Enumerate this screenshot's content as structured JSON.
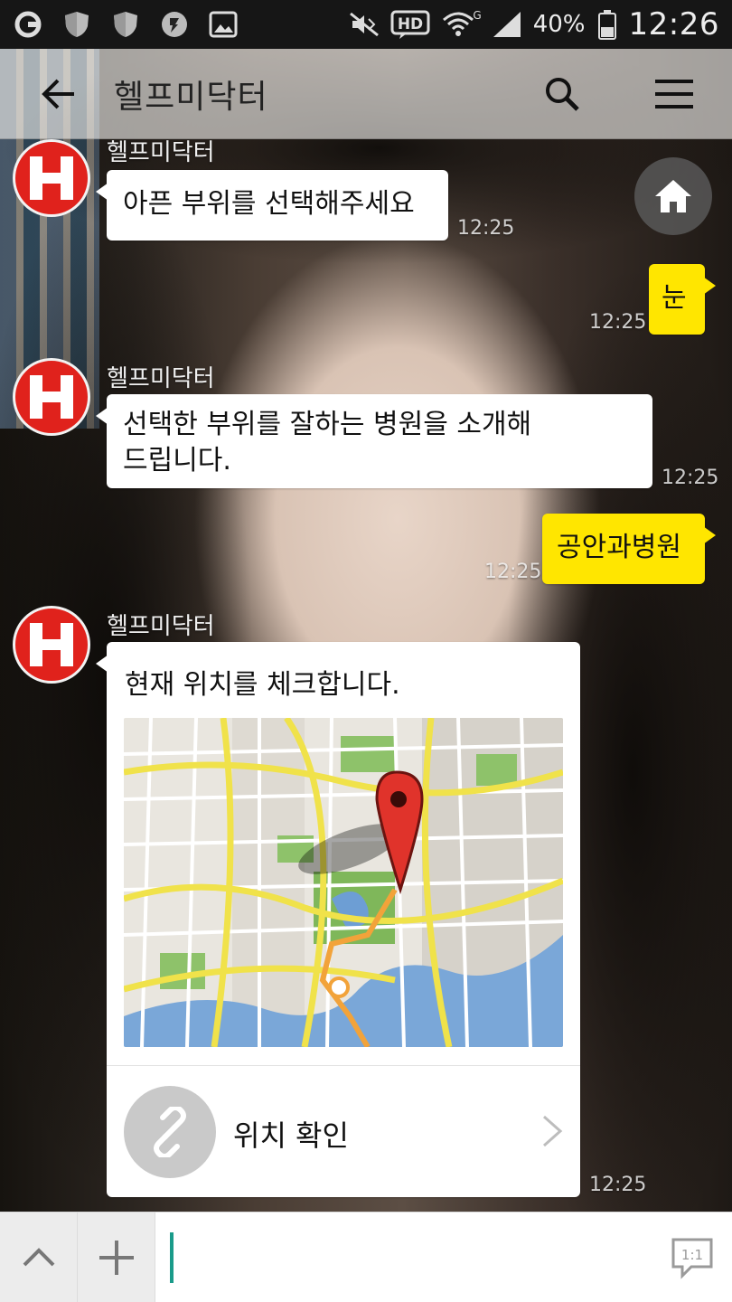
{
  "status_bar": {
    "icons": [
      "g-logo-icon",
      "shield-icon",
      "shield-icon",
      "location-icon",
      "image-icon",
      "mute-icon",
      "hd-icon",
      "wifi-icon",
      "signal-icon",
      "battery-icon"
    ],
    "hd_label": "HD",
    "wifi_label": "G",
    "battery": "40%",
    "time": "12:26"
  },
  "header": {
    "title": "헬프미닥터",
    "icons": [
      "back-arrow-icon",
      "search-icon",
      "menu-icon"
    ]
  },
  "chat": {
    "messages": [
      {
        "type": "incoming",
        "sender": "헬프미닥터",
        "text": "아픈 부위를 선택해주세요",
        "time": "12:25"
      },
      {
        "type": "outgoing",
        "text": "눈",
        "time": "12:25"
      },
      {
        "type": "incoming",
        "sender": "헬프미닥터",
        "line1": "선택한 부위를 잘하는 병원을 소개해",
        "line2": "드립니다.",
        "time": "12:25"
      },
      {
        "type": "outgoing",
        "text": "공안과병원",
        "time": "12:25"
      },
      {
        "type": "incoming-card",
        "sender": "헬프미닥터",
        "text": "현재 위치를 체크합니다.",
        "action_label": "위치 확인",
        "time": "12:25"
      }
    ],
    "home_icon": "home-icon"
  },
  "input_bar": {
    "icons": [
      "chevron-up-icon",
      "plus-icon",
      "one-to-one-icon"
    ],
    "one_to_one_label": "1:1",
    "value": ""
  },
  "colors": {
    "outgoing_bubble": "#ffe600",
    "incoming_bubble": "#ffffff",
    "avatar": "#e0221c",
    "caret": "#1a9b8a"
  }
}
